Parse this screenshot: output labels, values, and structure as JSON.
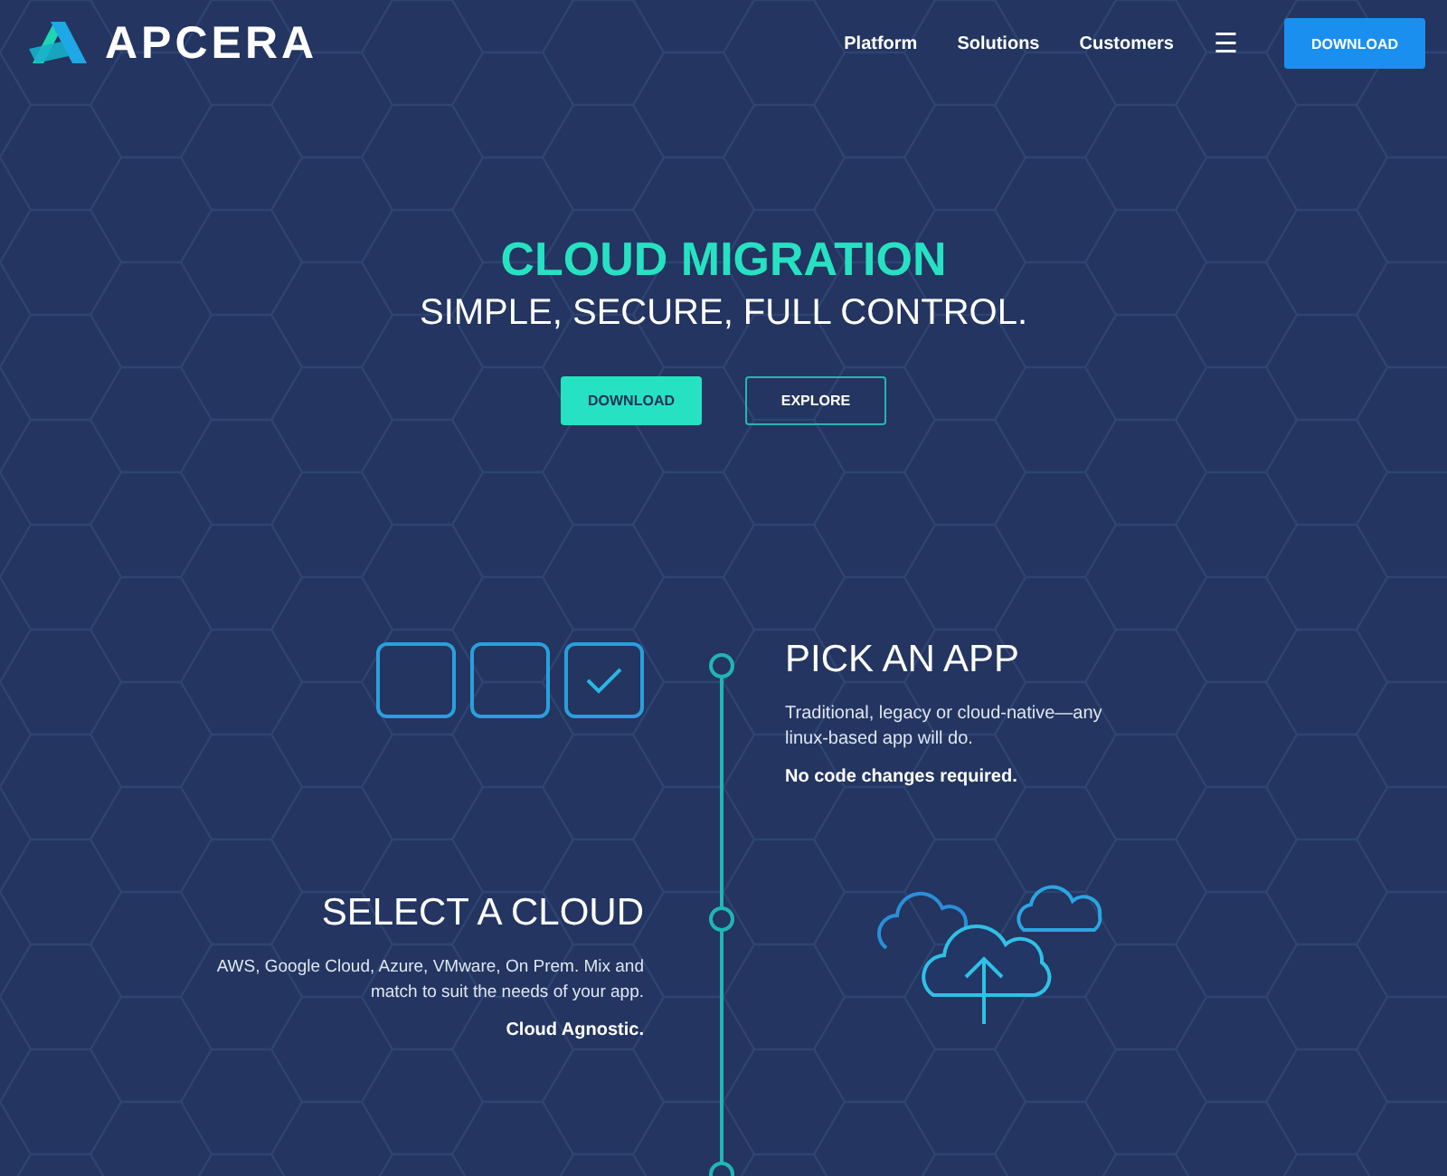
{
  "header": {
    "logo": "APCERA",
    "nav": [
      "Platform",
      "Solutions",
      "Customers"
    ],
    "menu_icon": "☰",
    "cta": "DOWNLOAD"
  },
  "hero": {
    "title": "CLOUD MIGRATION",
    "subtitle": "SIMPLE, SECURE, FULL CONTROL.",
    "buttons": [
      {
        "label": "DOWNLOAD",
        "kind": "primary"
      },
      {
        "label": "EXPLORE",
        "kind": "outline"
      }
    ]
  },
  "steps": [
    {
      "kind": "apps",
      "title": "PICK AN APP",
      "text": "Traditional, legacy or cloud-native—any linux-based app will do.",
      "note": "No code changes required.",
      "apps": [
        {
          "checked": false
        },
        {
          "checked": false
        },
        {
          "checked": true
        }
      ]
    },
    {
      "kind": "clouds",
      "title": "SELECT A CLOUD",
      "text": "AWS, Google Cloud, Azure, VMware, On Prem. Mix and match to suit the needs of your app.",
      "note": "Cloud Agnostic."
    }
  ]
}
